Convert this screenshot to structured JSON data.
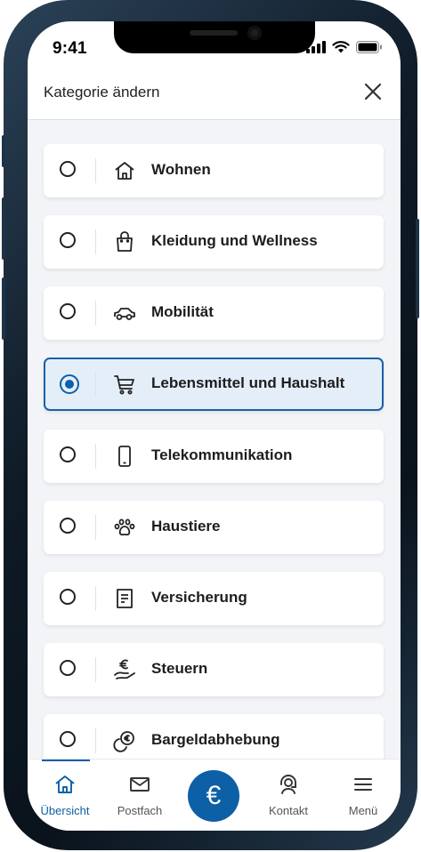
{
  "status_bar": {
    "time": "9:41"
  },
  "header": {
    "title": "Kategorie ändern"
  },
  "categories": [
    {
      "label": "Wohnen",
      "icon": "house-icon",
      "selected": false
    },
    {
      "label": "Kleidung und Wellness",
      "icon": "shopping-bag-icon",
      "selected": false
    },
    {
      "label": "Mobilität",
      "icon": "car-icon",
      "selected": false
    },
    {
      "label": "Lebensmittel und Haushalt",
      "icon": "shopping-cart-icon",
      "selected": true
    },
    {
      "label": "Telekommunikation",
      "icon": "smartphone-icon",
      "selected": false
    },
    {
      "label": "Haustiere",
      "icon": "paw-icon",
      "selected": false
    },
    {
      "label": "Versicherung",
      "icon": "document-icon",
      "selected": false
    },
    {
      "label": "Steuern",
      "icon": "hand-euro-icon",
      "selected": false
    },
    {
      "label": "Bargeldabhebung",
      "icon": "coins-icon",
      "selected": false
    }
  ],
  "tabbar": {
    "items": [
      {
        "label": "Übersicht",
        "icon": "home-icon",
        "active": true
      },
      {
        "label": "Postfach",
        "icon": "mail-icon",
        "active": false
      },
      {
        "label": "Kontakt",
        "icon": "headset-icon",
        "active": false
      },
      {
        "label": "Menü",
        "icon": "menu-icon",
        "active": false
      }
    ],
    "center_symbol": "€"
  },
  "colors": {
    "accent": "#0d5fa6",
    "selected_bg": "#e4eef8",
    "list_bg": "#f2f4f7"
  }
}
